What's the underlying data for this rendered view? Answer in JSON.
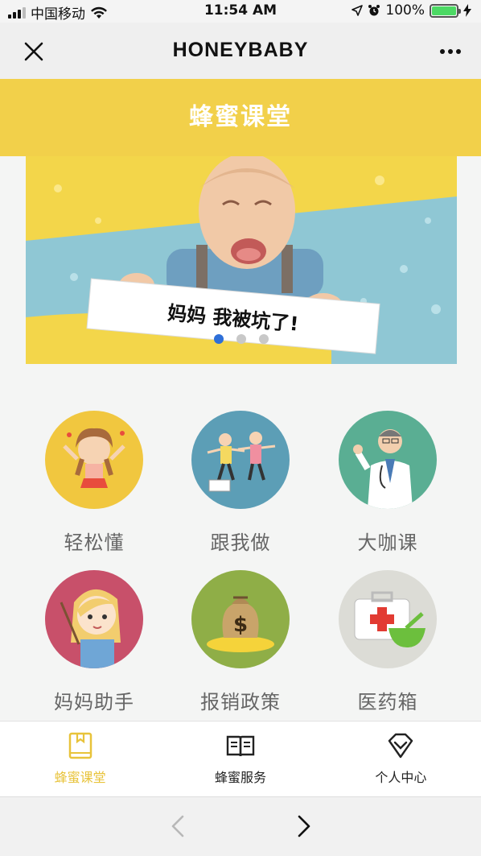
{
  "status_bar": {
    "carrier": "中国移动",
    "time": "11:54 AM",
    "battery_percent": "100%",
    "battery_level": 1.0,
    "signal_bars": 3
  },
  "nav": {
    "title": "HONEYBABY",
    "close_icon": "close-icon",
    "more_icon": "more-icon"
  },
  "header": {
    "title": "蜂蜜课堂"
  },
  "banner": {
    "sign_text": "妈妈  我被坑了!",
    "slide_count": 3,
    "active_slide": 1
  },
  "grid": {
    "items": [
      {
        "label": "轻松懂",
        "icon": "cartoon-girl-icon",
        "color": "#f1c73f"
      },
      {
        "label": "跟我做",
        "icon": "exercise-couple-icon",
        "color": "#5c9eb6"
      },
      {
        "label": "大咖课",
        "icon": "doctor-icon",
        "color": "#5aae93"
      },
      {
        "label": "妈妈助手",
        "icon": "teacher-girl-icon",
        "color": "#c8506a"
      },
      {
        "label": "报销政策",
        "icon": "money-bag-icon",
        "color": "#8fae47"
      },
      {
        "label": "医药箱",
        "icon": "medicine-box-icon",
        "color": "#dcdcd6"
      }
    ]
  },
  "tab_bar": {
    "tabs": [
      {
        "label": "蜂蜜课堂",
        "icon": "book-icon",
        "active": true
      },
      {
        "label": "蜂蜜服务",
        "icon": "open-book-icon",
        "active": false
      },
      {
        "label": "个人中心",
        "icon": "heart-diamond-icon",
        "active": false
      }
    ]
  },
  "colors": {
    "accent_yellow": "#f2d04a",
    "active_tab": "#e8c33a",
    "dot_active": "#2e6fd8"
  }
}
